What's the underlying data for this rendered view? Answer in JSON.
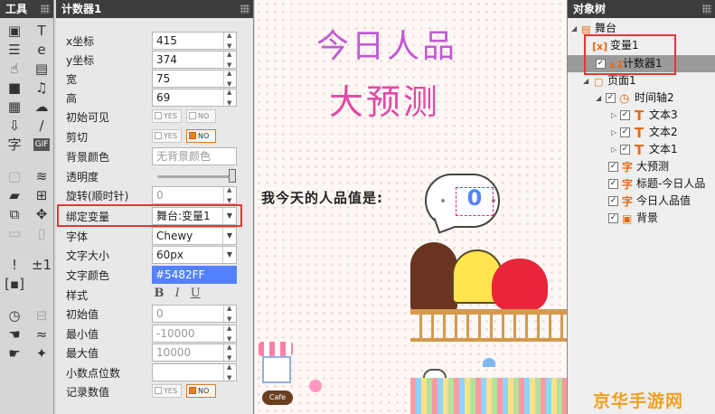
{
  "tools_panel": {
    "title": "工具"
  },
  "props_panel": {
    "title": "计数器1",
    "rows": [
      {
        "label": "x坐标",
        "value": "415"
      },
      {
        "label": "y坐标",
        "value": "374"
      },
      {
        "label": "宽",
        "value": "75"
      },
      {
        "label": "高",
        "value": "69"
      },
      {
        "label": "初始可见",
        "yes": "YES",
        "no": "NO",
        "selected": "no"
      },
      {
        "label": "剪切",
        "yes": "YES",
        "no": "NO",
        "selected": "no"
      },
      {
        "label": "背景颜色",
        "placeholder": "无背景颜色"
      },
      {
        "label": "透明度",
        "level": 1.0
      },
      {
        "label": "旋转(顺时针)",
        "value": "0"
      },
      {
        "label": "绑定变量",
        "value": "舞台:变量1"
      },
      {
        "label": "字体",
        "value": "Chewy"
      },
      {
        "label": "文字大小",
        "value": "60px"
      },
      {
        "label": "文字颜色",
        "value": "#5482FF"
      },
      {
        "label": "样式",
        "bold": "B",
        "italic": "I",
        "underline": "U"
      },
      {
        "label": "初始值",
        "value": "0"
      },
      {
        "label": "最小值",
        "value": "-10000"
      },
      {
        "label": "最大值",
        "value": "10000"
      },
      {
        "label": "小数点位数",
        "value": ""
      },
      {
        "label": "记录数值",
        "yes": "YES",
        "no": "NO",
        "selected": "no"
      }
    ]
  },
  "stage": {
    "title_line1": "今日人品",
    "title_line2": "大预测",
    "question": "我今天的人品值是:",
    "counter_value": "0",
    "cafe": "Cafe"
  },
  "tree_panel": {
    "title": "对象树",
    "items": [
      {
        "label": "舞台",
        "icon": "stage-icon"
      },
      {
        "label": "变量1",
        "icon": "variable-icon"
      },
      {
        "label": "计数器1",
        "icon": "counter-icon"
      },
      {
        "label": "页面1",
        "icon": "page-icon"
      },
      {
        "label": "时间轴2",
        "icon": "timeline-icon"
      },
      {
        "label": "文本3",
        "icon": "text-icon"
      },
      {
        "label": "文本2",
        "icon": "text-icon"
      },
      {
        "label": "文本1",
        "icon": "text-icon"
      },
      {
        "label": "大预测",
        "icon": "char-text-icon"
      },
      {
        "label": "标题-今日人品",
        "icon": "char-text-icon"
      },
      {
        "label": "今日人品值",
        "icon": "char-text-icon"
      },
      {
        "label": "背景",
        "icon": "image-icon"
      }
    ]
  },
  "watermark": "京华手游网",
  "colors": {
    "accent": "#5482FF",
    "highlight": "#E33333",
    "panel_header": "#3D3D3D",
    "toggle_on": "#F07E1E"
  }
}
